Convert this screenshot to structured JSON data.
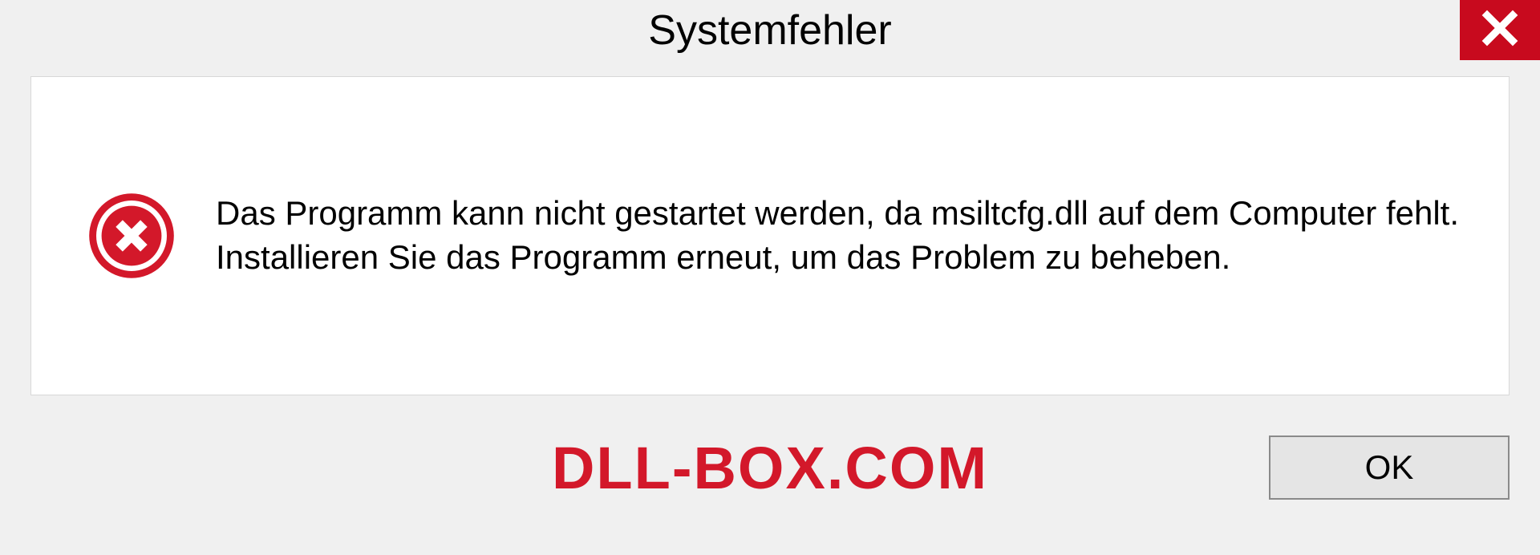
{
  "dialog": {
    "title": "Systemfehler",
    "message": "Das Programm kann nicht gestartet werden, da msiltcfg.dll auf dem Computer fehlt. Installieren Sie das Programm erneut, um das Problem zu beheben.",
    "ok_label": "OK"
  },
  "watermark": "DLL-BOX.COM"
}
